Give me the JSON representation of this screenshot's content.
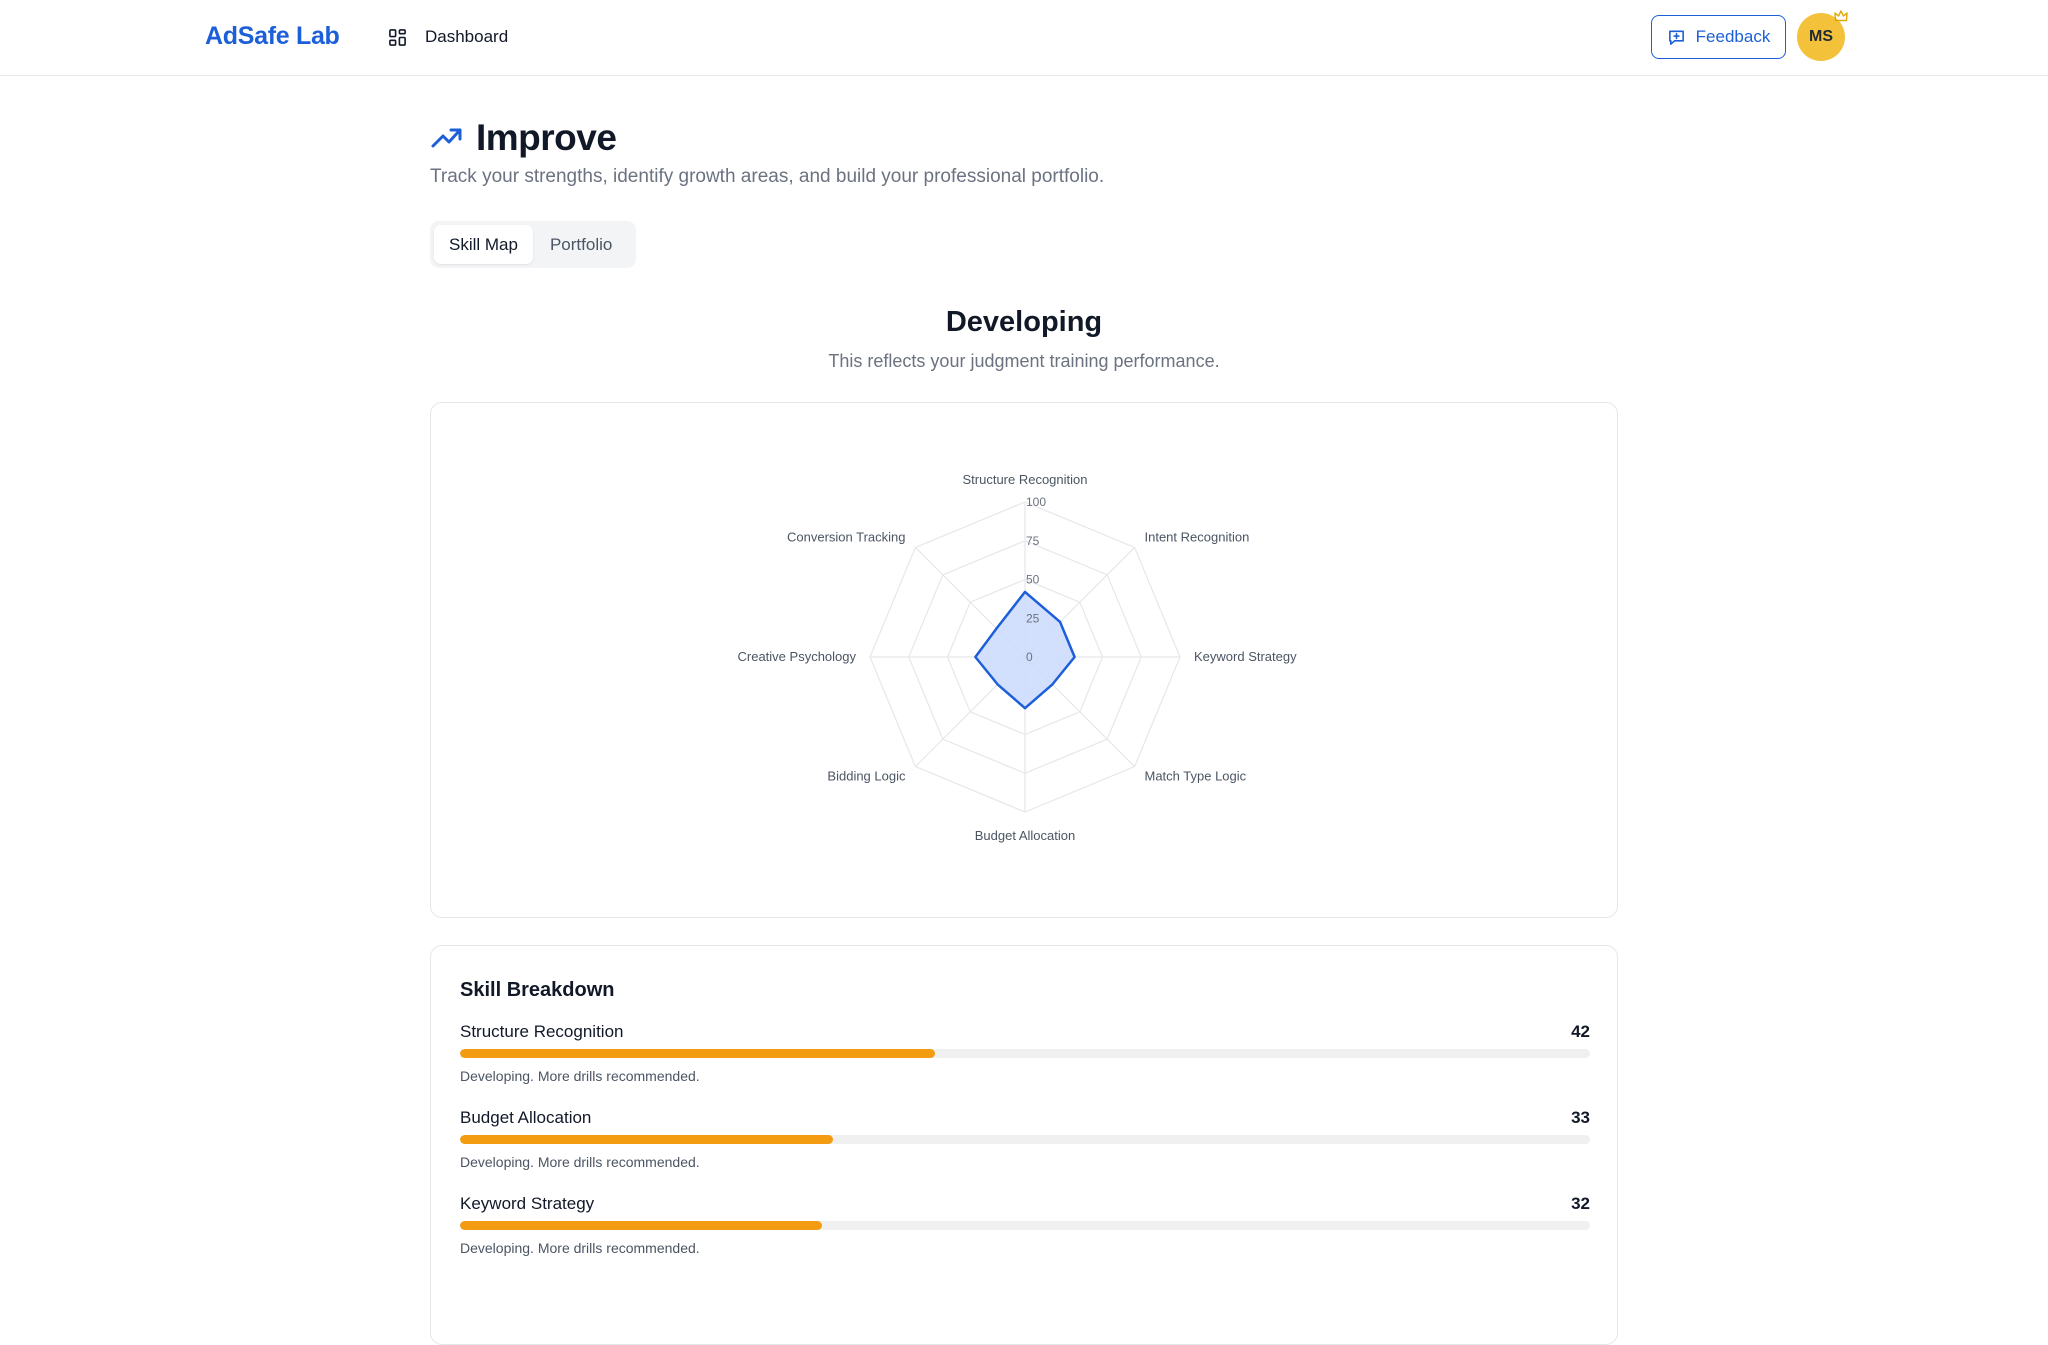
{
  "header": {
    "brand": "AdSafe Lab",
    "nav_dashboard": "Dashboard",
    "feedback_label": "Feedback",
    "avatar_initials": "MS"
  },
  "page": {
    "title": "Improve",
    "subtitle": "Track your strengths, identify growth areas, and build your professional portfolio.",
    "tabs": [
      {
        "label": "Skill Map",
        "active": true
      },
      {
        "label": "Portfolio",
        "active": false
      }
    ]
  },
  "level": {
    "title": "Developing",
    "subtitle": "This reflects your judgment training performance."
  },
  "colors": {
    "brand": "#1d5fd8",
    "radar_stroke": "#1d5fd8",
    "radar_fill": "#cddcfd",
    "bar_fill": "#f39c12"
  },
  "chart_data": {
    "type": "radar",
    "axes": [
      "Structure Recognition",
      "Intent Recognition",
      "Keyword Strategy",
      "Match Type Logic",
      "Budget Allocation",
      "Bidding Logic",
      "Creative Psychology",
      "Conversion Tracking"
    ],
    "values": [
      42,
      32,
      32,
      25,
      33,
      25,
      32,
      26
    ],
    "rlim": [
      0,
      100
    ],
    "ticks": [
      "0",
      "25",
      "50",
      "75",
      "100"
    ],
    "grid": true
  },
  "breakdown": {
    "title": "Skill Breakdown",
    "skills": [
      {
        "name": "Structure Recognition",
        "score": "42",
        "value": 42,
        "note": "Developing. More drills recommended."
      },
      {
        "name": "Budget Allocation",
        "score": "33",
        "value": 33,
        "note": "Developing. More drills recommended."
      },
      {
        "name": "Keyword Strategy",
        "score": "32",
        "value": 32,
        "note": "Developing. More drills recommended."
      }
    ]
  }
}
